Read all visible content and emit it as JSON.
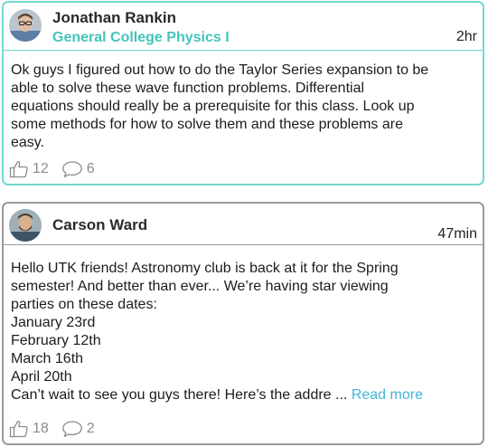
{
  "posts": [
    {
      "author": "Jonathan Rankin",
      "course": "General College Physics I",
      "time": "2hr",
      "body_lines": [
        "Ok guys I figured out how to do the Taylor Series expansion to be",
        "able to solve these wave function problems. Differential",
        "equations should really be a prerequisite for this class. Look up",
        "some methods for how to solve them and these problems are",
        "easy."
      ],
      "likes": "12",
      "comments": "6",
      "avatar_icon": "user-avatar-man-glasses",
      "accent_color": "#72d9d1"
    },
    {
      "author": "Carson Ward",
      "time": "47min",
      "body_lines": [
        "Hello UTK friends! Astronomy club is back at it for the Spring",
        "semester! And better than ever... We’re having star viewing",
        "parties on these dates:",
        "January 23rd",
        "February 12th",
        "March 16th",
        "April 20th"
      ],
      "body_last_line": "Can’t wait to see you guys there! Here’s the addre ...",
      "read_more": "Read more",
      "likes": "18",
      "comments": "2",
      "avatar_icon": "user-avatar-man-beard",
      "accent_color": "#9a9a9a"
    }
  ],
  "icons": {
    "like": "thumbs-up-icon",
    "comment": "speech-bubble-icon"
  },
  "colors": {
    "course": "#44c4ba",
    "read_more": "#44b6d6",
    "meta": "#8c8c8c"
  }
}
